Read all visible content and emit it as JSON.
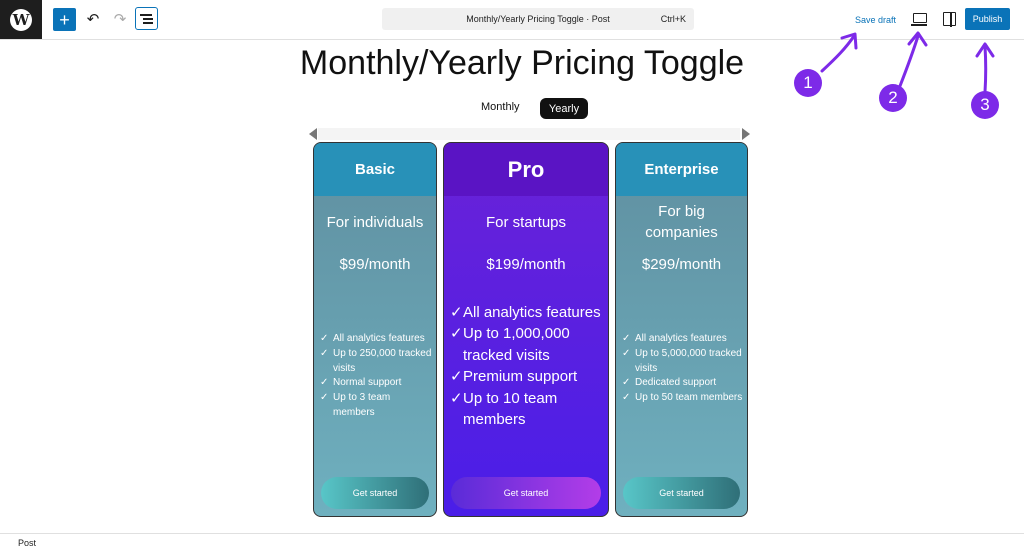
{
  "toolbar": {
    "wp_logo_icon": "wordpress-logo",
    "add_icon": "+",
    "undo_icon": "↶",
    "redo_icon": "↷",
    "command": {
      "title": "Monthly/Yearly Pricing Toggle · Post",
      "shortcut": "Ctrl+K"
    },
    "save_draft_label": "Save draft",
    "publish_label": "Publish"
  },
  "page": {
    "title": "Monthly/Yearly Pricing Toggle",
    "toggle": {
      "monthly_label": "Monthly",
      "yearly_label": "Yearly",
      "selected": "Yearly"
    }
  },
  "plans": [
    {
      "name": "Basic",
      "subtitle": "For individuals",
      "price": "$99/month",
      "features": [
        "All analytics features",
        "Up to 250,000 tracked visits",
        "Normal support",
        "Up to 3 team members"
      ],
      "cta": "Get started"
    },
    {
      "name": "Pro",
      "subtitle": "For startups",
      "price": "$199/month",
      "features": [
        "All analytics features",
        "Up to 1,000,000 tracked visits",
        "Premium support",
        "Up to 10 team members"
      ],
      "cta": "Get started"
    },
    {
      "name": "Enterprise",
      "subtitle": "For big companies",
      "price": "$299/month",
      "features": [
        "All analytics features",
        "Up to 5,000,000 tracked visits",
        "Dedicated support",
        "Up to 50 team members"
      ],
      "cta": "Get started"
    }
  ],
  "check_glyph": "✓",
  "annotations": {
    "badges": [
      "1",
      "2",
      "3"
    ],
    "color": "#7d2ae8"
  },
  "statusbar": {
    "label": "Post"
  },
  "colors": {
    "accent": "#0a73b8",
    "plan_header": "#2891b8",
    "pro_header": "#5a14c4"
  }
}
